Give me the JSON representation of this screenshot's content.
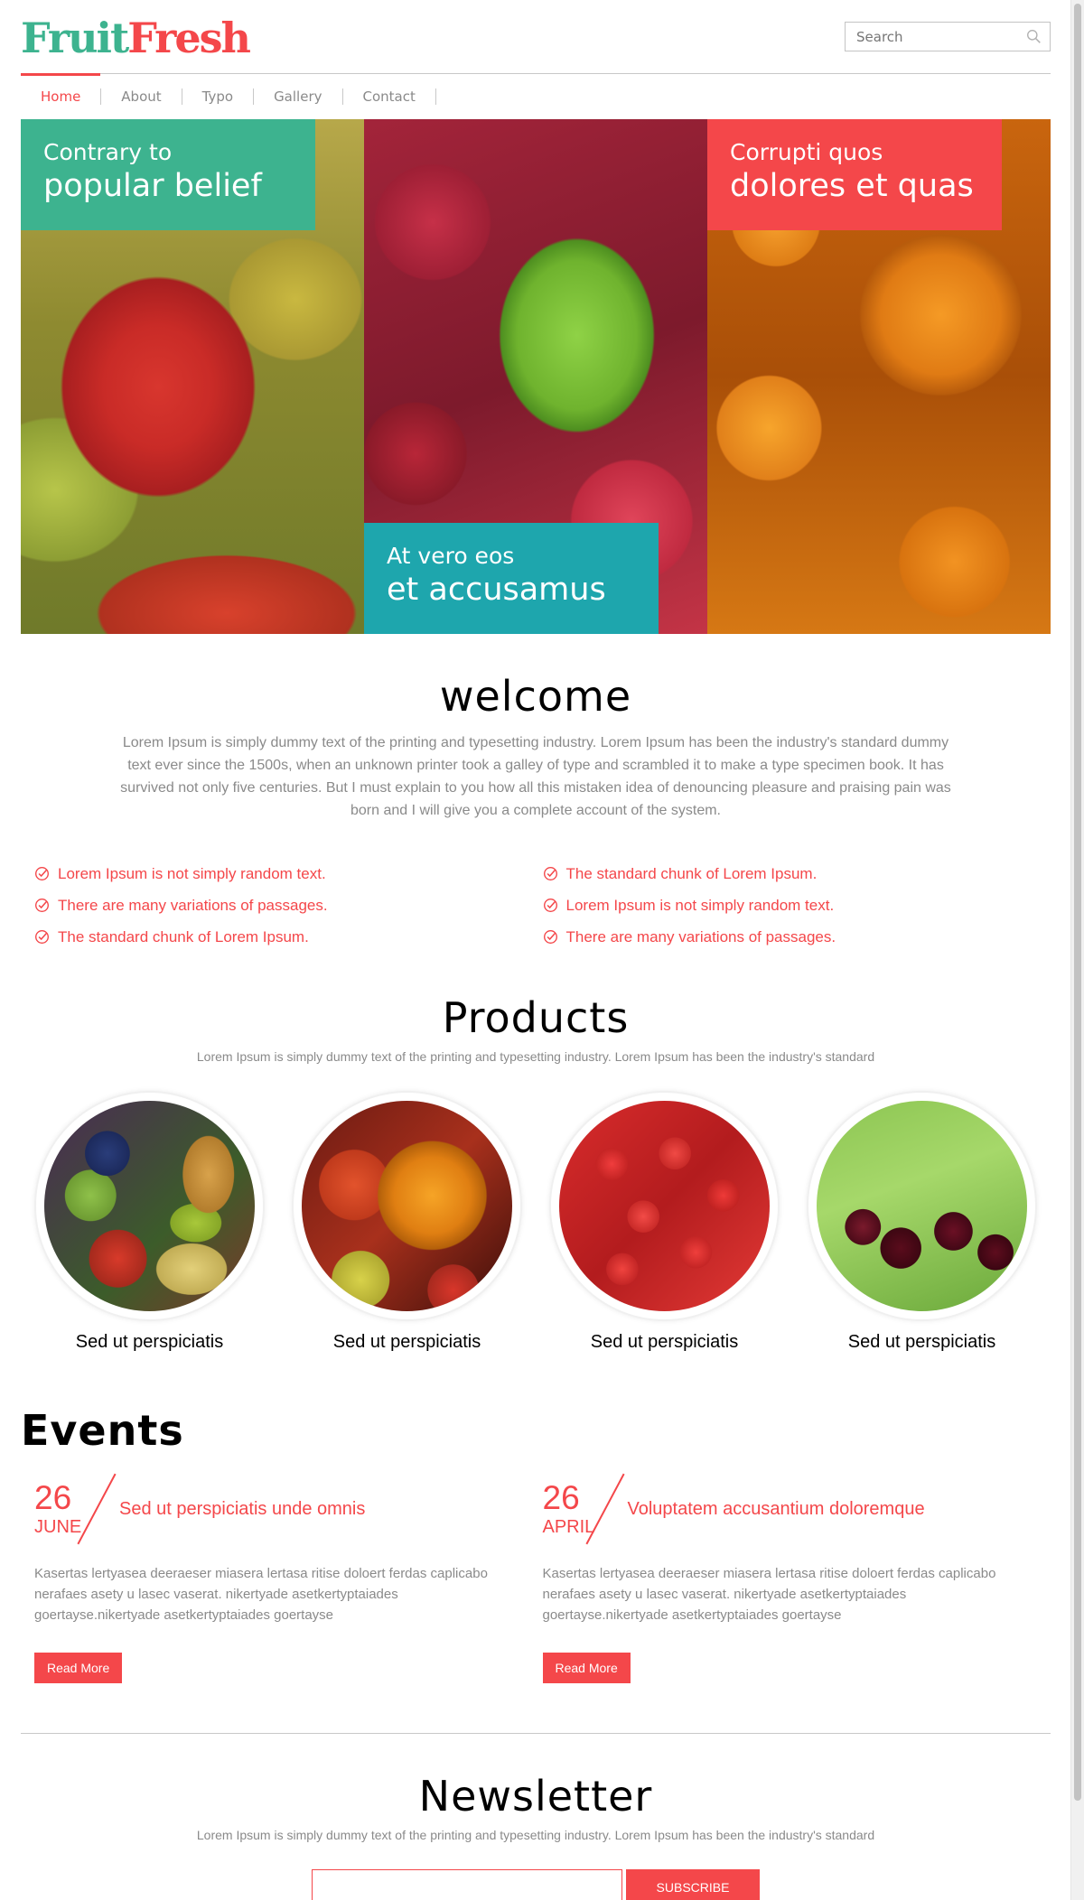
{
  "header": {
    "logo_part1": "Fruit",
    "logo_part2": "Fresh",
    "search_placeholder": "Search"
  },
  "nav": {
    "items": [
      {
        "label": "Home",
        "active": true
      },
      {
        "label": "About",
        "active": false
      },
      {
        "label": "Typo",
        "active": false
      },
      {
        "label": "Gallery",
        "active": false
      },
      {
        "label": "Contact",
        "active": false
      }
    ]
  },
  "hero": {
    "panels": [
      {
        "small": "Contrary to",
        "big": "popular belief"
      },
      {
        "small": "At vero eos",
        "big": "et accusamus"
      },
      {
        "small": "Corrupti quos",
        "big": "dolores et quas"
      }
    ]
  },
  "welcome": {
    "title": "welcome",
    "text": "Lorem Ipsum is simply dummy text of the printing and typesetting industry. Lorem Ipsum has been the industry's standard dummy text ever since the 1500s, when an unknown printer took a galley of type and scrambled it to make a type specimen book. It has survived not only five centuries. But I must explain to you how all this mistaken idea of denouncing pleasure and praising pain was born and I will give you a complete account of the system.",
    "list_left": [
      "Lorem Ipsum is not simply random text.",
      "There are many variations of passages.",
      "The standard chunk of Lorem Ipsum."
    ],
    "list_right": [
      "The standard chunk of Lorem Ipsum.",
      "Lorem Ipsum is not simply random text.",
      "There are many variations of passages."
    ]
  },
  "products": {
    "title": "Products",
    "subtitle": "Lorem Ipsum is simply dummy text of the printing and typesetting industry. Lorem Ipsum has been the industry's standard",
    "items": [
      {
        "name": "Sed ut perspiciatis"
      },
      {
        "name": "Sed ut perspiciatis"
      },
      {
        "name": "Sed ut perspiciatis"
      },
      {
        "name": "Sed ut perspiciatis"
      }
    ]
  },
  "events": {
    "title": "Events",
    "items": [
      {
        "day": "26",
        "month": "JUNE",
        "title": "Sed ut perspiciatis unde omnis",
        "text": "Kasertas lertyasea deeraeser miasera lertasa ritise doloert ferdas caplicabo nerafaes asety u lasec vaserat. nikertyade asetkertyptaiades goertayse.nikertyade asetkertyptaiades goertayse",
        "button": "Read More"
      },
      {
        "day": "26",
        "month": "APRIL",
        "title": "Voluptatem accusantium doloremque",
        "text": "Kasertas lertyasea deeraeser miasera lertasa ritise doloert ferdas caplicabo nerafaes asety u lasec vaserat. nikertyade asetkertyptaiades goertayse.nikertyade asetkertyptaiades goertayse",
        "button": "Read More"
      }
    ]
  },
  "newsletter": {
    "title": "Newsletter",
    "subtitle": "Lorem Ipsum is simply dummy text of the printing and typesetting industry. Lorem Ipsum has been the industry's standard",
    "input_value": "",
    "button": "SUBSCRIBE"
  },
  "colors": {
    "brand_green": "#3db38f",
    "brand_red": "#f4474a",
    "teal": "#1ea6ad",
    "text_grey": "#8a8a8a"
  }
}
